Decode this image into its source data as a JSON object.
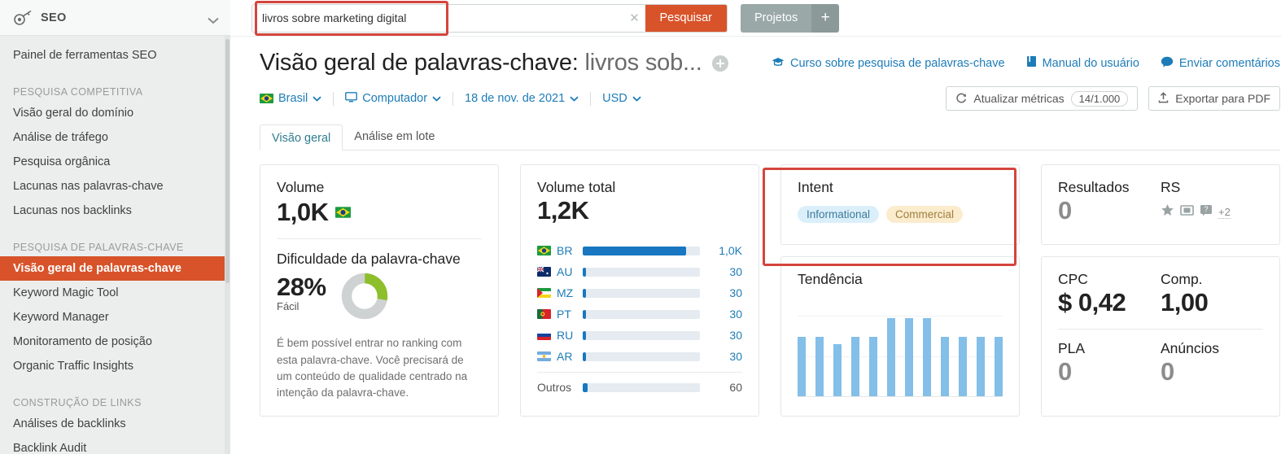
{
  "sidebar": {
    "header": {
      "title": "SEO",
      "icon": "key-icon",
      "chevron": "chevron-down-icon"
    },
    "items": [
      {
        "type": "item",
        "label": "Painel de ferramentas SEO",
        "active": false
      },
      {
        "type": "group",
        "label": "PESQUISA COMPETITIVA"
      },
      {
        "type": "item",
        "label": "Visão geral do domínio",
        "active": false
      },
      {
        "type": "item",
        "label": "Análise de tráfego",
        "active": false
      },
      {
        "type": "item",
        "label": "Pesquisa orgânica",
        "active": false
      },
      {
        "type": "item",
        "label": "Lacunas nas palavras-chave",
        "active": false
      },
      {
        "type": "item",
        "label": "Lacunas nos backlinks",
        "active": false
      },
      {
        "type": "group",
        "label": "PESQUISA DE PALAVRAS-CHAVE"
      },
      {
        "type": "item",
        "label": "Visão geral de palavras-chave",
        "active": true
      },
      {
        "type": "item",
        "label": "Keyword Magic Tool",
        "active": false
      },
      {
        "type": "item",
        "label": "Keyword Manager",
        "active": false
      },
      {
        "type": "item",
        "label": "Monitoramento de posição",
        "active": false
      },
      {
        "type": "item",
        "label": "Organic Traffic Insights",
        "active": false
      },
      {
        "type": "group",
        "label": "CONSTRUÇÃO DE LINKS"
      },
      {
        "type": "item",
        "label": "Análises de backlinks",
        "active": false
      },
      {
        "type": "item",
        "label": "Backlink Audit",
        "active": false
      }
    ]
  },
  "topbar": {
    "search_value": "livros sobre marketing digital",
    "search_placeholder": "",
    "clear_icon": "close-icon",
    "search_button": "Pesquisar",
    "projects_button": "Projetos",
    "projects_plus": "+"
  },
  "header": {
    "title_prefix": "Visão geral de palavras-chave: ",
    "title_keyword": "livros sob...",
    "add_icon": "plus-circle-icon",
    "links": [
      {
        "label": "Curso sobre pesquisa de palavras-chave",
        "icon": "graduation-cap-icon"
      },
      {
        "label": "Manual do usuário",
        "icon": "book-icon"
      },
      {
        "label": "Enviar comentários",
        "icon": "comment-icon"
      }
    ]
  },
  "filters": {
    "database": "Brasil",
    "device": "Computador",
    "date": "18 de nov. de 2021",
    "currency": "USD",
    "refresh_label": "Atualizar métricas",
    "refresh_count": "14/1.000",
    "export_label": "Exportar para PDF"
  },
  "tabs": [
    {
      "label": "Visão geral",
      "active": true
    },
    {
      "label": "Análise em lote",
      "active": false
    }
  ],
  "cards": {
    "volume": {
      "label": "Volume",
      "value": "1,0K",
      "flag": "br-flag-icon",
      "difficulty_label": "Dificuldade da palavra-chave",
      "difficulty_value": "28%",
      "difficulty_percent": 28,
      "difficulty_sub": "Fácil",
      "difficulty_note": "É bem possível entrar no ranking com esta palavra-chave. Você precisará de um conteúdo de qualidade centrado na intenção da palavra-chave."
    },
    "total_volume": {
      "label": "Volume total",
      "value": "1,2K",
      "rows": [
        {
          "code": "BR",
          "flag": "br-flag-icon",
          "value": "1,0K",
          "percent": 88
        },
        {
          "code": "AU",
          "flag": "au-flag-icon",
          "value": "30",
          "percent": 3
        },
        {
          "code": "MZ",
          "flag": "mz-flag-icon",
          "value": "30",
          "percent": 3
        },
        {
          "code": "PT",
          "flag": "pt-flag-icon",
          "value": "30",
          "percent": 3
        },
        {
          "code": "RU",
          "flag": "ru-flag-icon",
          "value": "30",
          "percent": 3
        },
        {
          "code": "AR",
          "flag": "ar-flag-icon",
          "value": "30",
          "percent": 3
        }
      ],
      "other": {
        "code": "Outros",
        "value": "60",
        "percent": 4
      }
    },
    "intent": {
      "label": "Intent",
      "tags": [
        {
          "label": "Informational",
          "kind": "info"
        },
        {
          "label": "Commercial",
          "kind": "comm"
        }
      ]
    },
    "trend": {
      "label": "Tendência"
    },
    "results": {
      "results_label": "Resultados",
      "results_value": "0",
      "serp_label": "RS",
      "icons": [
        "star-icon",
        "reviews-icon",
        "faq-icon"
      ],
      "more": "+2"
    },
    "cpc": {
      "cpc_label": "CPC",
      "cpc_value": "$ 0,42",
      "comp_label": "Comp.",
      "comp_value": "1,00",
      "pla_label": "PLA",
      "pla_value": "0",
      "ads_label": "Anúncios",
      "ads_value": "0"
    }
  },
  "chart_data": {
    "type": "bar",
    "title": "Tendência",
    "categories": [
      "1",
      "2",
      "3",
      "4",
      "5",
      "6",
      "7",
      "8",
      "9",
      "10",
      "11",
      "12"
    ],
    "values": [
      1000,
      1000,
      880,
      1000,
      1000,
      1300,
      1300,
      1300,
      1000,
      1000,
      1000,
      1000
    ],
    "xlabel": "",
    "ylabel": "",
    "ylim": [
      0,
      1400
    ],
    "grid": true,
    "legend": false,
    "series_color": "#83bfe8"
  },
  "annotations": [
    {
      "name": "search-input-highlight",
      "color": "#d4453d"
    },
    {
      "name": "intent-card-highlight",
      "color": "#d4453d"
    }
  ]
}
